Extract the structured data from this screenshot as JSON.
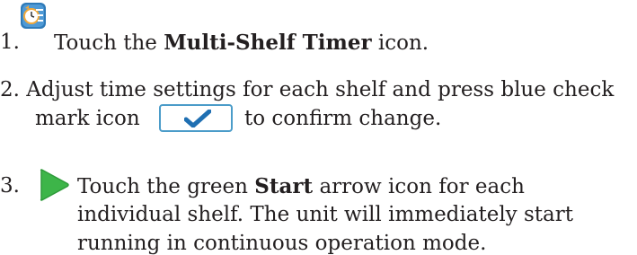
{
  "steps": [
    {
      "number": "1.",
      "icon": "multi-shelf-timer-icon",
      "text_before": "Touch the ",
      "bold": "Multi-Shelf Timer",
      "text_after": " icon."
    },
    {
      "number": "2.",
      "line1": "Adjust time settings for each shelf and press blue check",
      "line2_before": "mark icon",
      "icon": "check-mark-icon",
      "line2_after": "to confirm change."
    },
    {
      "number": "3.",
      "icon": "start-arrow-icon",
      "line1_before": "Touch the green ",
      "bold": "Start",
      "line1_after": " arrow icon for each",
      "line2": "individual shelf. The unit will immediately start",
      "line3": "running in continuous operation mode."
    }
  ],
  "colors": {
    "text": "#231f20",
    "check_button_border": "#4b9cc9",
    "check_mark": "#1f6fb2",
    "start_arrow": "#3db549",
    "timer_icon_bg": "#2e7ab8"
  }
}
